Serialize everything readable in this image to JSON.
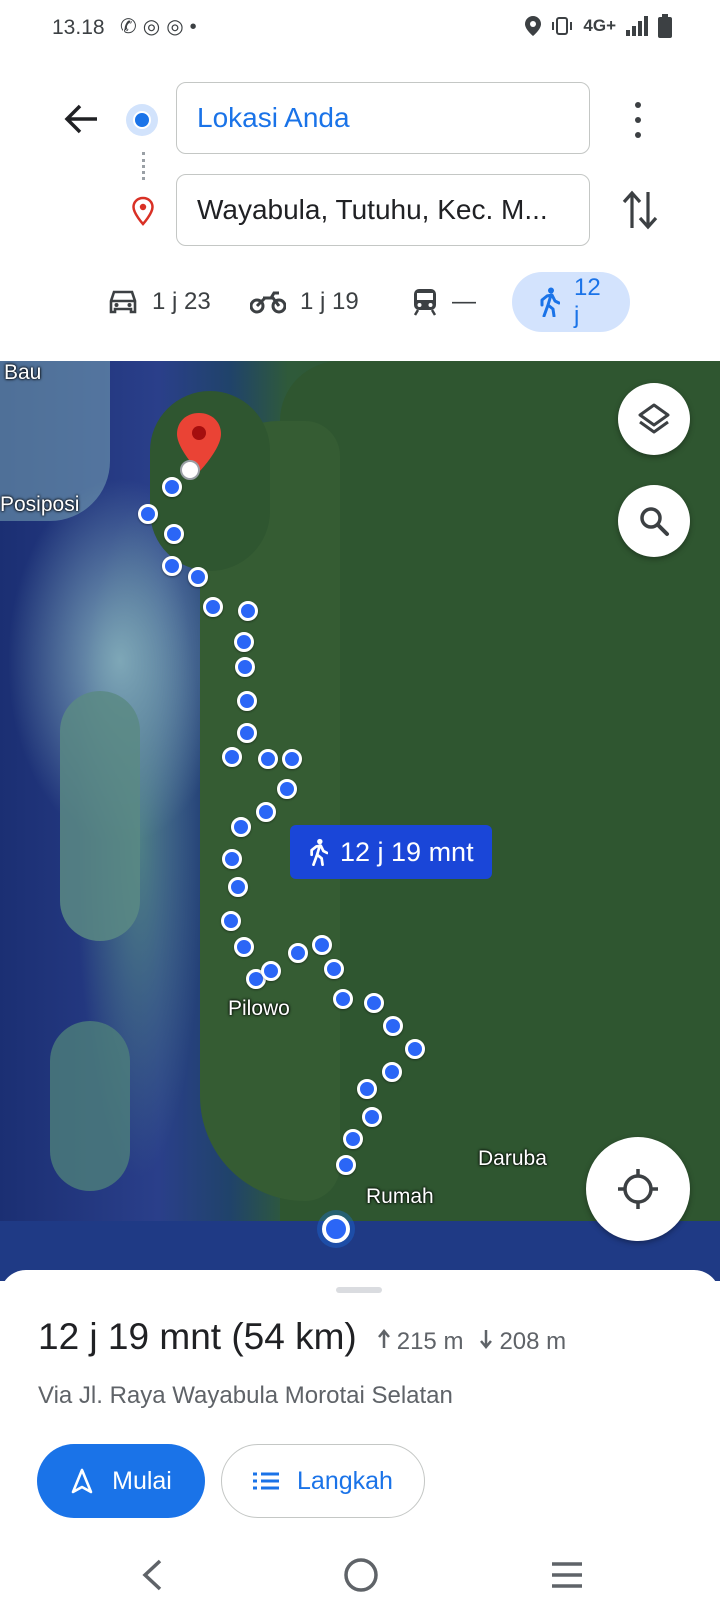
{
  "status_bar": {
    "time": "13.18",
    "network": "4G+"
  },
  "directions": {
    "origin": "Lokasi Anda",
    "destination": "Wayabula, Tutuhu, Kec. M..."
  },
  "modes": [
    {
      "name": "car",
      "label": "1 j 23"
    },
    {
      "name": "motorcycle",
      "label": "1 j 19"
    },
    {
      "name": "transit",
      "label": "—"
    },
    {
      "name": "walk",
      "label": "12 j",
      "selected": true
    }
  ],
  "map": {
    "labels": {
      "bau": "Bau",
      "posiposi": "Posiposi",
      "pilowo": "Pilowo",
      "daruba": "Daruba",
      "rumah": "Rumah"
    },
    "route_label": "12 j 19 mnt"
  },
  "route_summary": {
    "duration": "12 j 19 mnt (54 km)",
    "ascent": "215 m",
    "descent": "208 m",
    "via": "Via Jl. Raya Wayabula Morotai Selatan"
  },
  "actions": {
    "start": "Mulai",
    "steps": "Langkah"
  },
  "colors": {
    "accent": "#1a73e8",
    "route": "#2b66f6",
    "pin": "#d93025"
  }
}
